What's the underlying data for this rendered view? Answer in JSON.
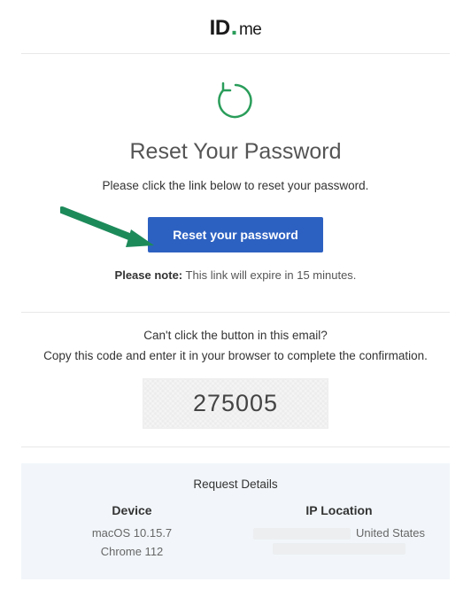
{
  "logo": {
    "id_part": "ID",
    "me_part": "me"
  },
  "heading": "Reset Your Password",
  "subtext": "Please click the link below to reset your password.",
  "reset_button_label": "Reset your password",
  "note": {
    "bold": "Please note:",
    "text": " This link will expire in 15 minutes."
  },
  "alt": {
    "line1": "Can't click the button in this email?",
    "line2": "Copy this code and enter it in your browser to complete the confirmation."
  },
  "confirmation_code": "275005",
  "details": {
    "title": "Request Details",
    "device_header": "Device",
    "device_os": "macOS 10.15.7",
    "device_browser": "Chrome 112",
    "ip_header": "IP Location",
    "ip_country": "United States"
  }
}
